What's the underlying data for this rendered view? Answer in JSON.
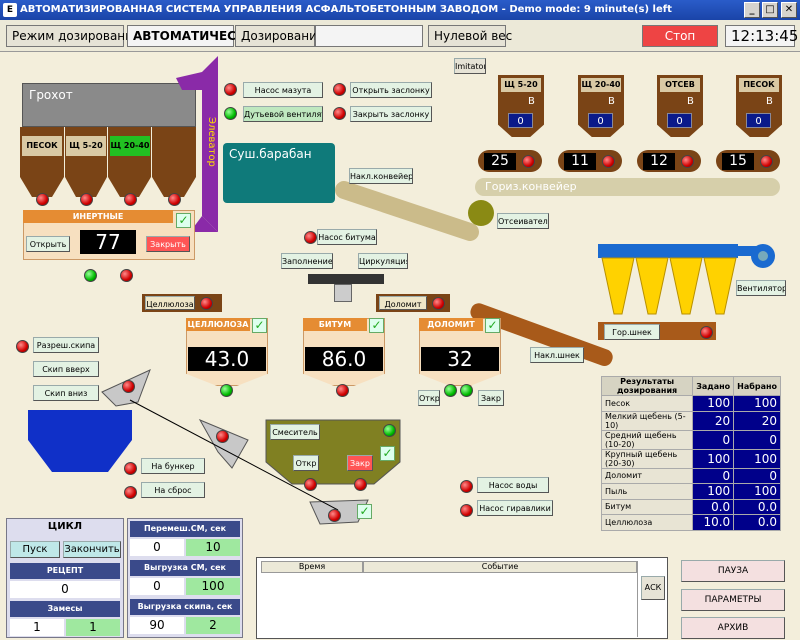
{
  "window": {
    "title": "АВТОМАТИЗИРОВАННАЯ СИСТЕМА УПРАВЛЕНИЯ АСФАЛЬТОБЕТОННЫМ ЗАВОДОМ - Demo mode: 9 minute(s) left",
    "icon": "E",
    "min": "_",
    "max": "□",
    "close": "✕"
  },
  "toolbar": {
    "mode_label": "Режим дозирования",
    "mode_value": "АВТОМАТИЧЕСКИЙ",
    "dosing_label": "Дозирование",
    "dosing_value": "",
    "zero_weight": "Нулевой вес",
    "stop": "Стоп",
    "clock": "12:13:45"
  },
  "imitator": "Imitator",
  "screen": {
    "label": "Грохот"
  },
  "bins": [
    "ПЕСОК",
    "Щ 5-20",
    "Щ 20-40"
  ],
  "elevator": "Элеватор",
  "inert": {
    "title": "ИНЕРТНЫЕ",
    "value": "77",
    "open": "Открыть",
    "close": "Закрыть"
  },
  "buttons": {
    "pump_mazut": "Насос мазута",
    "blower": "Дутьевой вентилятор",
    "open_valve": "Открыть заслонку",
    "close_valve": "Закрыть заслонку",
    "pump_bitumen": "Насос битума",
    "fill": "Заполнение",
    "circulation": "Циркуляция",
    "cellulose": "Целлюлоза",
    "dolomite": "Доломит",
    "skip_perm": "Разреш.скипа",
    "skip_up": "Скип вверх",
    "skip_down": "Скип вниз",
    "to_bunker": "На бункер",
    "to_discharge": "На сброс",
    "mixer": "Смеситель",
    "mix_open": "Откр",
    "mix_close": "Закр",
    "pump_water": "Насос воды",
    "pump_hydraulics": "Насос гиравлики",
    "incl_conveyor": "Накл.конвейер",
    "screen_sorter": "Отсеиватель",
    "incl_screw": "Накл.шнек",
    "fan": "Вентилятор",
    "hor_screw": "Гор.шнек",
    "dol_open": "Откр",
    "dol_close": "Закр"
  },
  "dryer": "Суш.барабан",
  "hopper_bins": [
    {
      "name": "Щ 5-20",
      "unit": "В",
      "value": "0",
      "count": "25"
    },
    {
      "name": "Щ 20-40",
      "unit": "В",
      "value": "0",
      "count": "11"
    },
    {
      "name": "ОТСЕВ",
      "unit": "В",
      "value": "0",
      "count": "12"
    },
    {
      "name": "ПЕСОК",
      "unit": "В",
      "value": "0",
      "count": "15"
    }
  ],
  "hor_conveyor": "Гориз.конвейер",
  "dosers": [
    {
      "name": "ЦЕЛЛЮЛОЗА",
      "value": "43.0"
    },
    {
      "name": "БИТУМ",
      "value": "86.0"
    },
    {
      "name": "ДОЛОМИТ",
      "value": "32"
    }
  ],
  "results": {
    "headers": [
      "Результаты дозирования",
      "Задано",
      "Набрано"
    ],
    "rows": [
      [
        "Песок",
        "100",
        "100"
      ],
      [
        "Мелкий щебень (5-10)",
        "20",
        "20"
      ],
      [
        "Средний щебень (10-20)",
        "0",
        "0"
      ],
      [
        "Крупный щебень (20-30)",
        "100",
        "100"
      ],
      [
        "Доломит",
        "0",
        "0"
      ],
      [
        "Пыль",
        "100",
        "100"
      ],
      [
        "Битум",
        "0.0",
        "0.0"
      ],
      [
        "Целлюлоза",
        "10.0",
        "0.0"
      ]
    ]
  },
  "cycle": {
    "title": "ЦИКЛ",
    "start": "Пуск",
    "finish": "Закончить",
    "recipe_label": "РЕЦЕПТ",
    "recipe_value": "0",
    "batches_label": "Замесы",
    "batches_a": "1",
    "batches_b": "1"
  },
  "timers": [
    {
      "label": "Перемеш.СМ, сек",
      "a": "0",
      "b": "10"
    },
    {
      "label": "Выгрузка СМ, сек",
      "a": "0",
      "b": "100"
    },
    {
      "label": "Выгрузка скипа, сек",
      "a": "90",
      "b": "2"
    }
  ],
  "log": {
    "col_time": "Время",
    "col_event": "Событие",
    "ack": "АСК"
  },
  "side": {
    "pause": "ПАУЗА",
    "params": "ПАРАМЕТРЫ",
    "archive": "АРХИВ"
  }
}
